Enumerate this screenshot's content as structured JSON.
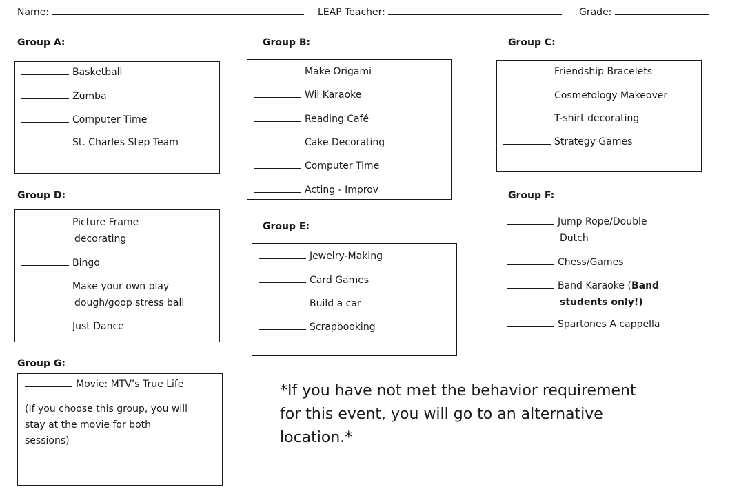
{
  "header": {
    "name_label": "Name:",
    "teacher_label": "LEAP Teacher:",
    "grade_label": "Grade:"
  },
  "groups": {
    "A": {
      "label": "Group A:",
      "items": [
        "Basketball",
        "Zumba",
        "Computer Time",
        "St. Charles Step Team"
      ]
    },
    "B": {
      "label": "Group B:",
      "items": [
        "Make Origami",
        "Wii Karaoke",
        "Reading Café",
        "Cake Decorating",
        "Computer Time",
        "Acting - Improv"
      ]
    },
    "C": {
      "label": "Group C:",
      "items": [
        "Friendship Bracelets",
        "Cosmetology Makeover",
        "T-shirt decorating",
        "Strategy Games"
      ]
    },
    "D": {
      "label": "Group D:",
      "items": [
        {
          "line1": "Picture Frame",
          "line2": "decorating"
        },
        {
          "line1": "Bingo"
        },
        {
          "line1": "Make your own play",
          "line2": "dough/goop stress ball"
        },
        {
          "line1": "Just Dance"
        }
      ]
    },
    "E": {
      "label": "Group E:",
      "items": [
        "Jewelry-Making",
        "Card Games",
        "Build a car",
        "Scrapbooking"
      ]
    },
    "F": {
      "label": "Group F:",
      "items": [
        {
          "line1": "Jump Rope/Double",
          "line2": "Dutch"
        },
        {
          "line1": "Chess/Games"
        },
        {
          "line1": "Band Karaoke (",
          "line1_bold": "Band",
          "line2_bold": "students only!)"
        },
        {
          "line1": "Spartones A cappella"
        }
      ]
    },
    "G": {
      "label": "Group G:",
      "items": [
        "Movie: MTV’s True Life"
      ],
      "note_lines": [
        "(If you choose this group, you will",
        "stay at the movie for both",
        "sessions)"
      ]
    }
  },
  "notice": {
    "lines": [
      "*If you have not met the behavior requirement",
      "for this event, you will go to an alternative",
      "location.*"
    ]
  }
}
